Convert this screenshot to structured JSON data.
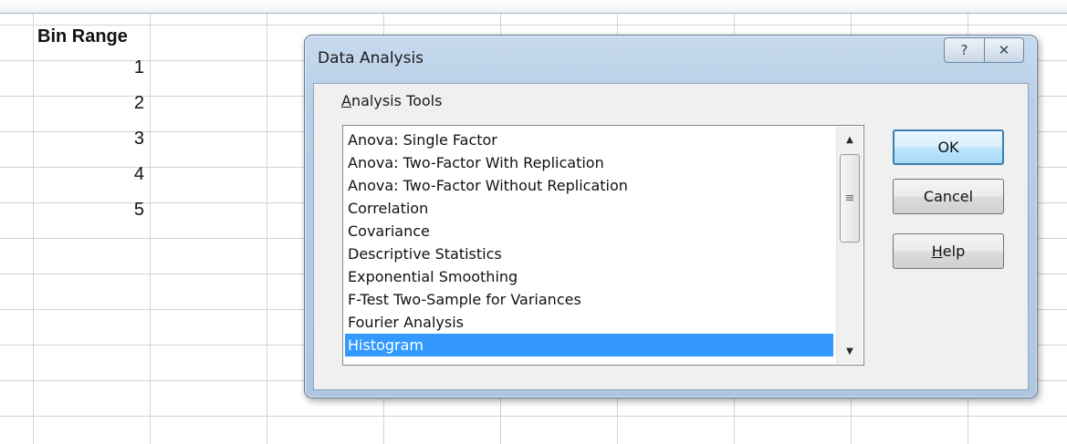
{
  "spreadsheet": {
    "column_a_header": "Bin Range",
    "bin_values": [
      "1",
      "2",
      "3",
      "4",
      "5"
    ]
  },
  "dialog": {
    "title": "Data Analysis",
    "help_glyph": "?",
    "close_glyph": "✕",
    "tools_label_first": "A",
    "tools_label_rest": "nalysis Tools",
    "items": [
      "Anova: Single Factor",
      "Anova: Two-Factor With Replication",
      "Anova: Two-Factor Without Replication",
      "Correlation",
      "Covariance",
      "Descriptive Statistics",
      "Exponential Smoothing",
      "F-Test Two-Sample for Variances",
      "Fourier Analysis",
      "Histogram"
    ],
    "selected_item": "Histogram",
    "buttons": {
      "ok": "OK",
      "cancel": "Cancel",
      "help_first": "H",
      "help_rest": "elp"
    },
    "scroll_up_glyph": "▲",
    "scroll_down_glyph": "▼",
    "scroll_grip_glyph": "≡"
  },
  "colors": {
    "selection": "#3399ff",
    "dialog_frame": "#b9cfe6",
    "grid": "#d4d4d4"
  }
}
